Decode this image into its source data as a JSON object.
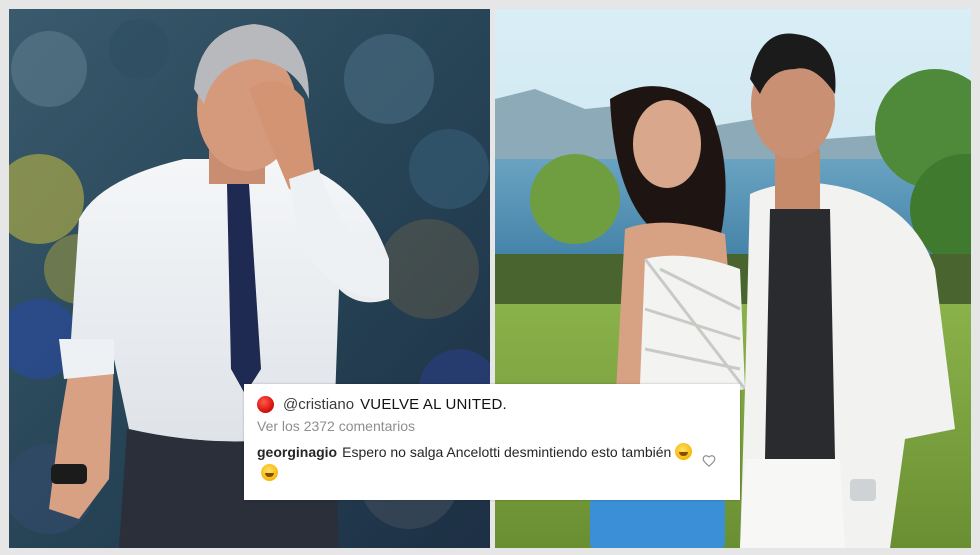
{
  "comment": {
    "handle": "@cristiano",
    "headline": "VUELVE AL UNITED.",
    "view_comments": "Ver los 2372 comentarios",
    "reply_user": "georginagio",
    "reply_text": "Espero no salga Ancelotti desmintiendo esto también",
    "emojis": [
      "woozy-face-emoji",
      "grinning-sweat-emoji"
    ]
  },
  "colors": {
    "record_dot": "#e0140e",
    "secondary_text": "#8e8e8e"
  }
}
